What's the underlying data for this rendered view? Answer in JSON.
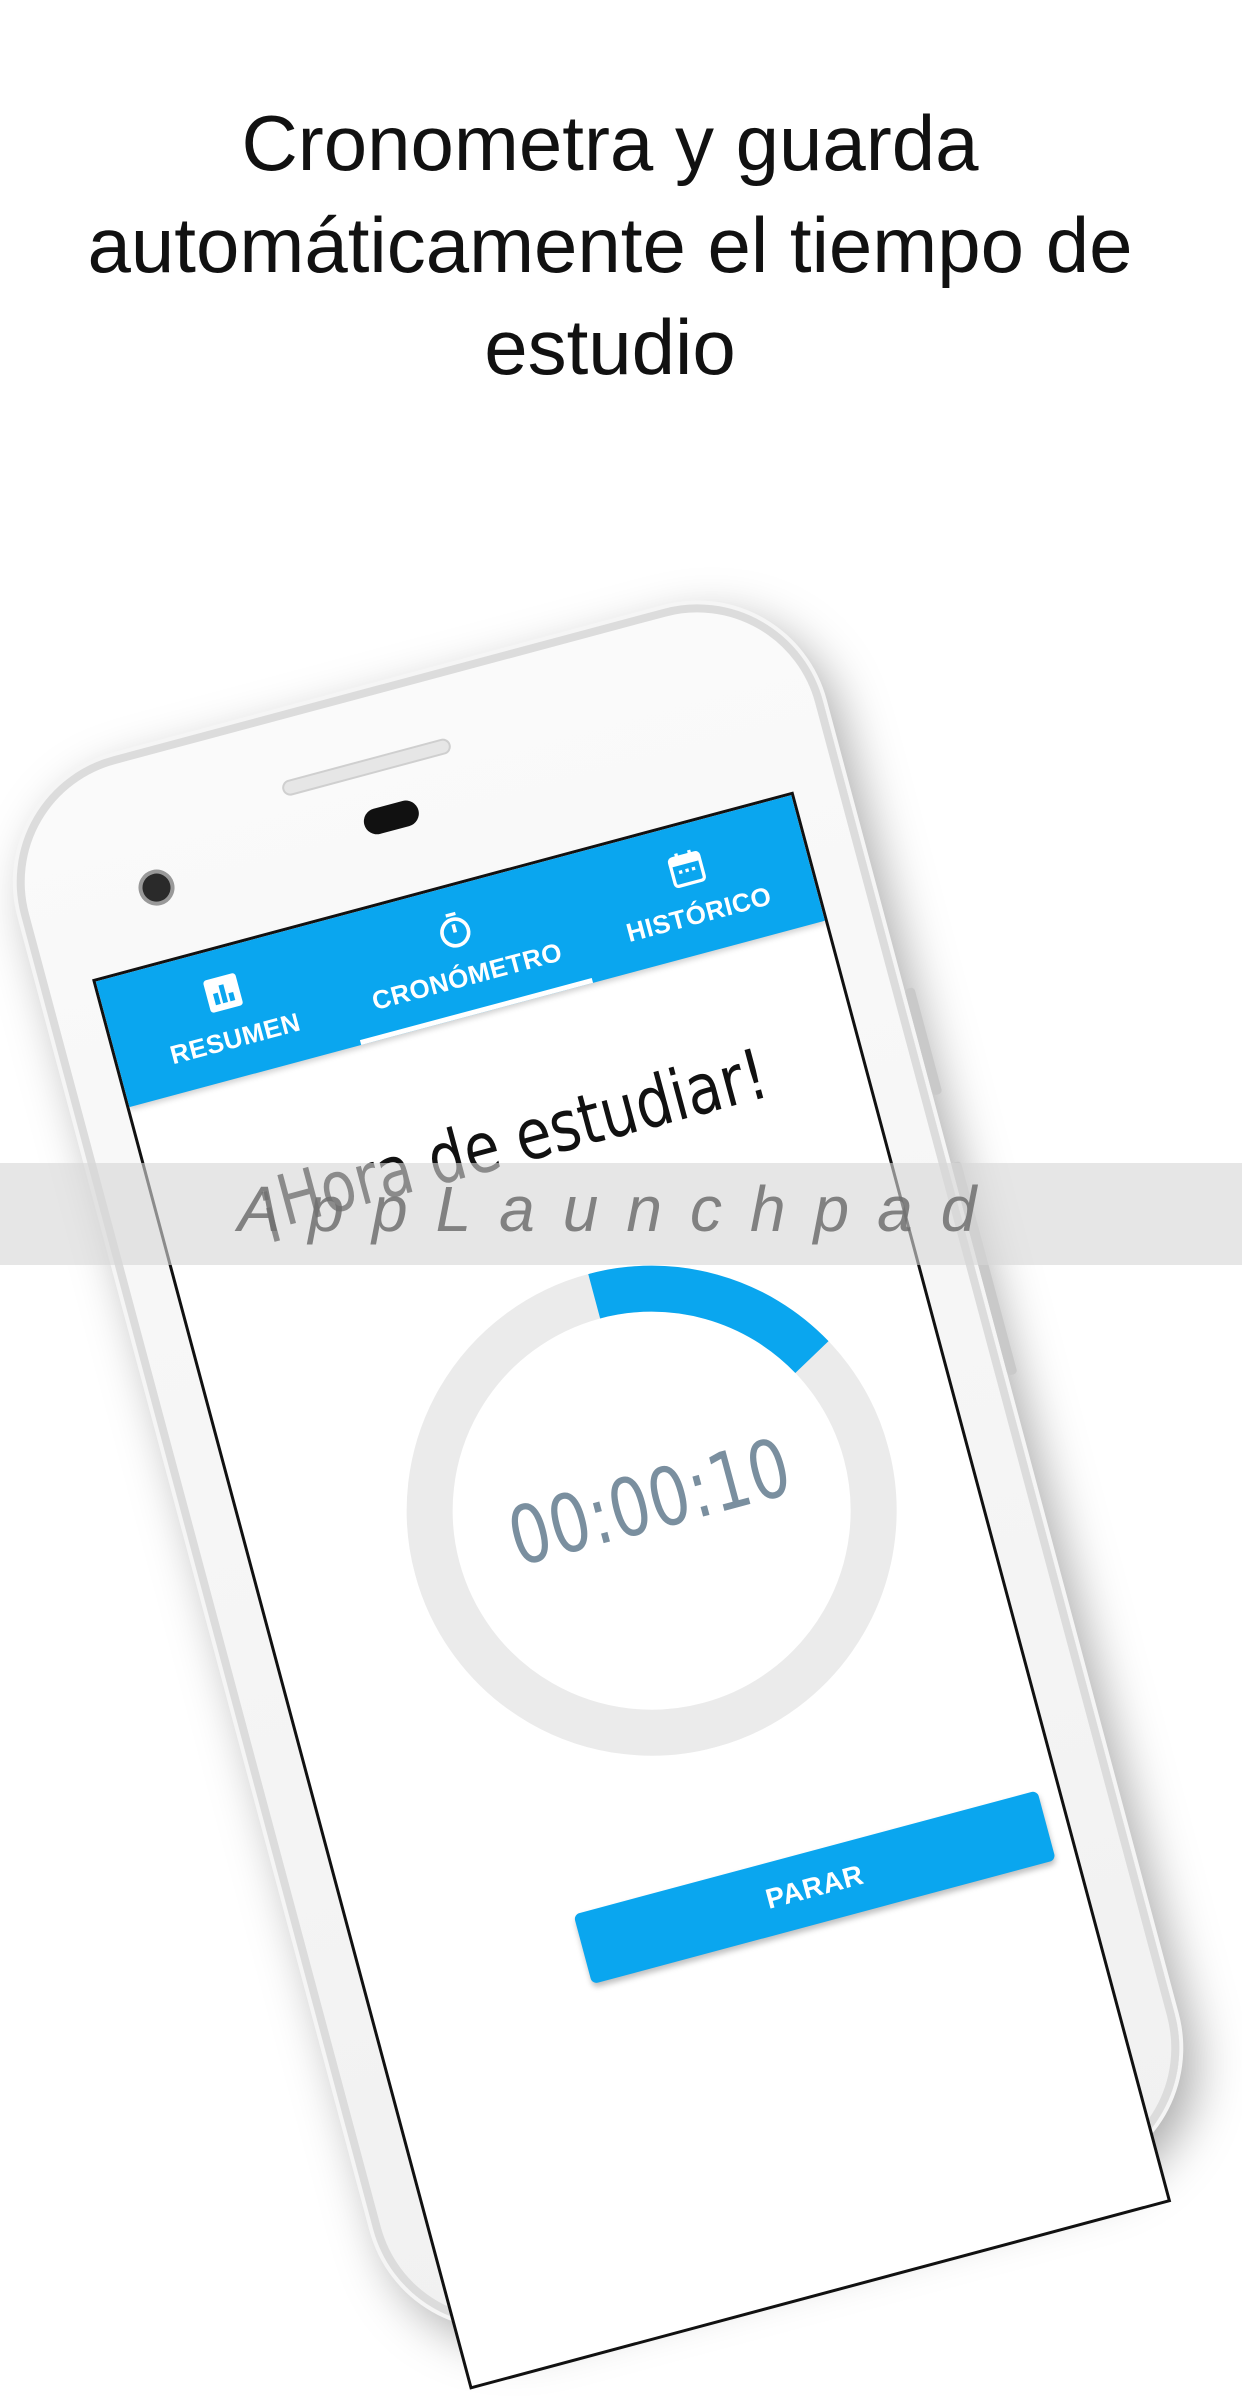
{
  "headline": "Cronometra y guarda automáticamente el tiempo de estudio",
  "tabs": [
    {
      "label": "RESUMEN",
      "icon": "bar-chart-icon",
      "active": false
    },
    {
      "label": "CRONÓMETRO",
      "icon": "stopwatch-icon",
      "active": true
    },
    {
      "label": "HISTÓRICO",
      "icon": "calendar-icon",
      "active": false
    }
  ],
  "greeting": "¡Hora de estudiar!",
  "timer": {
    "value": "00:00:10",
    "progress_fraction": 0.17
  },
  "stop_label": "PARAR",
  "watermark": "AppLaunchpad",
  "colors": {
    "accent": "#0aa6ef",
    "ring_track": "#ebebeb",
    "timer_text": "#7a8f9f"
  }
}
